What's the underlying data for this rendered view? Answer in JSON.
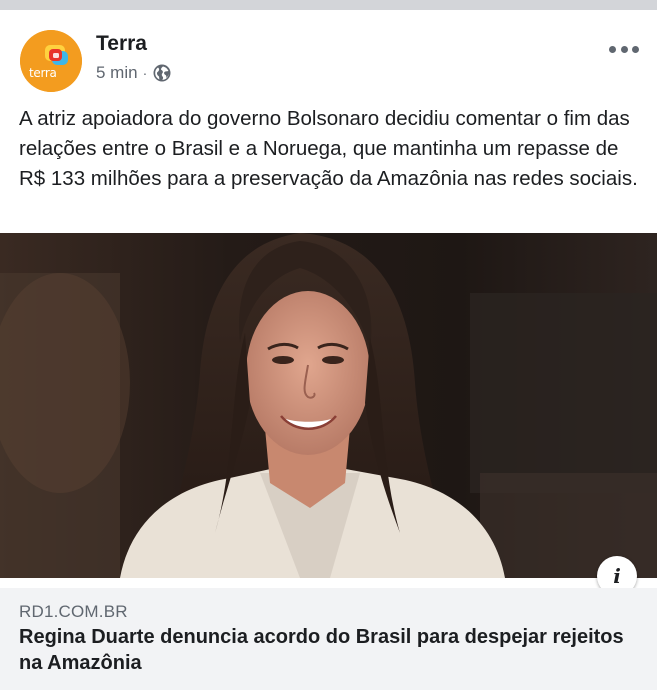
{
  "post": {
    "page_name": "Terra",
    "avatar_label": "terra",
    "timestamp": "5 min",
    "separator": "·",
    "audience_icon": "globe-icon",
    "more_icon": "more-options-icon",
    "text": "A atriz apoiadora do governo Bolsonaro decidiu comentar o fim das relações entre o Brasil e a Noruega, que mantinha um repasse de R$ 133 milhões para a preservação da Amazônia nas redes sociais."
  },
  "link": {
    "domain": "RD1.COM.BR",
    "title": "Regina Duarte denuncia acordo do Brasil para despejar rejeitos na Amazônia",
    "info_label": "i"
  },
  "colors": {
    "brand_orange": "#f39c1f",
    "text_primary": "#1c1e21",
    "text_secondary": "#606770",
    "caption_bg": "#f2f3f5"
  }
}
